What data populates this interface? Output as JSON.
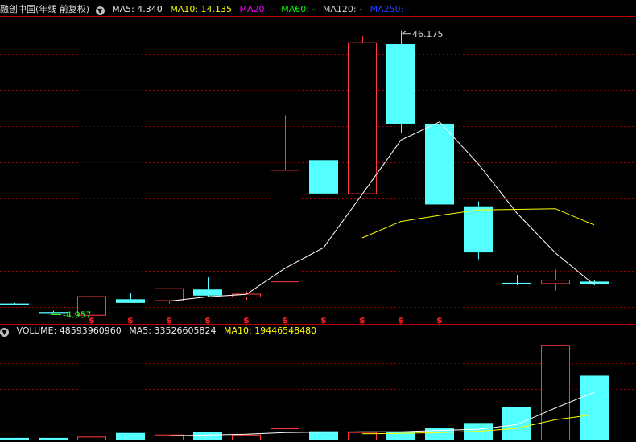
{
  "header": {
    "title": "融创中国(年线 前复权)",
    "ma5": "MA5: 4.340",
    "ma10": "MA10: 14.135",
    "ma20": "MA20: -",
    "ma60": "MA60: -",
    "ma120": "MA120: -",
    "ma250": "MA250: -"
  },
  "volume_header": {
    "volume": "VOLUME: 48593960960",
    "ma5": "MA5: 33526605824",
    "ma10": "MA10: 19446548480"
  },
  "colors": {
    "up": "#ff3b3b",
    "down": "#54ffff",
    "ma5_line": "#ffffff",
    "ma10_line": "#ffff00",
    "ma20_label": "#ff00ff",
    "ma60_label": "#00ff00",
    "ma120_label": "#cfcfcf",
    "ma250_label": "#2040ff",
    "marker": "#ff2020",
    "grid": "#9a0000"
  },
  "chart_data": [
    {
      "type": "candlestick",
      "title": "融创中国(年线 前复权)",
      "candles": [
        {
          "open": 1.2,
          "high": 1.3,
          "low": 0.9,
          "close": 0.9
        },
        {
          "open": -0.2,
          "high": 0.0,
          "low": -0.5,
          "close": -0.5
        },
        {
          "open": -0.8,
          "high": 2.4,
          "low": -0.8,
          "close": 2.4
        },
        {
          "open": 1.9,
          "high": 2.9,
          "low": 1.3,
          "close": 1.3
        },
        {
          "open": 1.6,
          "high": 3.7,
          "low": 1.2,
          "close": 3.7
        },
        {
          "open": 3.5,
          "high": 5.5,
          "low": 2.2,
          "close": 2.5
        },
        {
          "open": 2.2,
          "high": 3.2,
          "low": 1.8,
          "close": 2.8
        },
        {
          "open": 4.7,
          "high": 32.2,
          "low": 4.7,
          "close": 23.2
        },
        {
          "open": 24.8,
          "high": 29.3,
          "low": 12.5,
          "close": 19.3
        },
        {
          "open": 19.2,
          "high": 45.2,
          "low": 19.2,
          "close": 44.2
        },
        {
          "open": 43.9,
          "high": 46.175,
          "low": 29.3,
          "close": 30.8
        },
        {
          "open": 30.8,
          "high": 36.5,
          "low": 16.0,
          "close": 17.5
        },
        {
          "open": 17.2,
          "high": 18.0,
          "low": 8.5,
          "close": 9.6
        },
        {
          "open": 4.6,
          "high": 5.9,
          "low": 4.2,
          "close": 4.4
        },
        {
          "open": 4.4,
          "high": 6.8,
          "low": 3.3,
          "close": 5.1
        },
        {
          "open": 4.8,
          "high": 5.1,
          "low": 4.2,
          "close": 4.34
        }
      ],
      "ma5": [
        null,
        null,
        null,
        null,
        1.6,
        2.3,
        2.7,
        7.0,
        10.4,
        19.2,
        28.1,
        31.1,
        24.2,
        16.1,
        9.5,
        4.3
      ],
      "ma10": [
        null,
        null,
        null,
        null,
        null,
        null,
        null,
        null,
        null,
        12.0,
        14.7,
        15.7,
        16.6,
        16.7,
        16.8,
        14.135
      ],
      "annotations": {
        "max_label": "46.175",
        "min_label": "-4.957",
        "max_index": 10,
        "min_index": 1,
        "max_value": 46.175,
        "min_value": -0.9
      },
      "marker_symbol": "$",
      "marker_indices": [
        2,
        3,
        4,
        5,
        6,
        7,
        8,
        9,
        10,
        11
      ],
      "ylim": [
        -1.5,
        48
      ],
      "grid": true
    },
    {
      "type": "bar",
      "title": "VOLUME",
      "values": [
        0.3,
        0.3,
        0.45,
        0.9,
        0.7,
        1.0,
        0.7,
        1.45,
        1.1,
        1.0,
        1.0,
        1.45,
        2.1,
        4.0,
        11.5,
        7.8
      ],
      "up": [
        false,
        false,
        true,
        false,
        true,
        false,
        true,
        true,
        false,
        true,
        false,
        false,
        false,
        false,
        true,
        false
      ],
      "ma5": [
        null,
        null,
        null,
        null,
        0.55,
        0.65,
        0.75,
        0.95,
        1.0,
        1.05,
        1.05,
        1.2,
        1.35,
        1.9,
        3.9,
        5.8
      ],
      "ma10": [
        null,
        null,
        null,
        null,
        null,
        null,
        null,
        null,
        null,
        0.8,
        0.85,
        0.95,
        1.1,
        1.45,
        2.5,
        3.1
      ],
      "ylim": [
        0,
        12.2
      ],
      "grid": true
    }
  ]
}
